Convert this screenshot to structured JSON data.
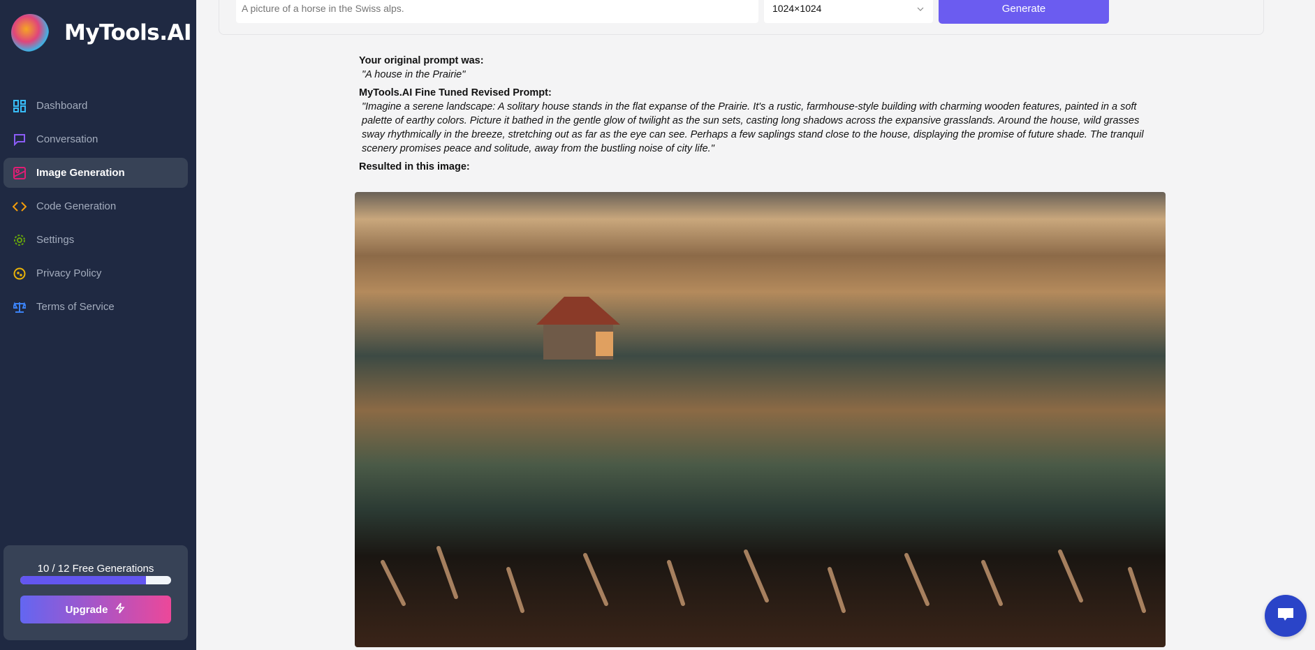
{
  "brand": {
    "name": "MyTools.AI"
  },
  "sidebar": {
    "items": [
      {
        "label": "Dashboard",
        "icon": "dashboard-icon",
        "color": "#38bdf8"
      },
      {
        "label": "Conversation",
        "icon": "chat-icon",
        "color": "#8b5cf6"
      },
      {
        "label": "Image Generation",
        "icon": "image-icon",
        "color": "#e11d74",
        "active": true
      },
      {
        "label": "Code Generation",
        "icon": "code-icon",
        "color": "#f59e0b"
      },
      {
        "label": "Settings",
        "icon": "gear-icon",
        "color": "#65a30d"
      },
      {
        "label": "Privacy Policy",
        "icon": "cookie-icon",
        "color": "#eab308"
      },
      {
        "label": "Terms of Service",
        "icon": "scale-icon",
        "color": "#3b82f6"
      }
    ]
  },
  "usage": {
    "label": "10 / 12 Free Generations",
    "used": 10,
    "total": 12,
    "upgrade_label": "Upgrade"
  },
  "form": {
    "prompt_placeholder": "A picture of a horse in the Swiss alps.",
    "size": "1024×1024",
    "generate_label": "Generate"
  },
  "result": {
    "original_heading": "Your original prompt was:",
    "original_prompt": "\"A house in the Prairie\"",
    "revised_heading": "MyTools.AI Fine Tuned Revised Prompt:",
    "revised_prompt": "\"Imagine a serene landscape: A solitary house stands in the flat expanse of the Prairie. It's a rustic, farmhouse-style building with charming wooden features, painted in a soft palette of earthy colors. Picture it bathed in the gentle glow of twilight as the sun sets, casting long shadows across the expansive grasslands. Around the house, wild grasses sway rhythmically in the breeze, stretching out as far as the eye can see. Perhaps a few saplings stand close to the house, displaying the promise of future shade. The tranquil scenery promises peace and solitude, away from the bustling noise of city life.\"",
    "result_heading": "Resulted in this image:"
  }
}
